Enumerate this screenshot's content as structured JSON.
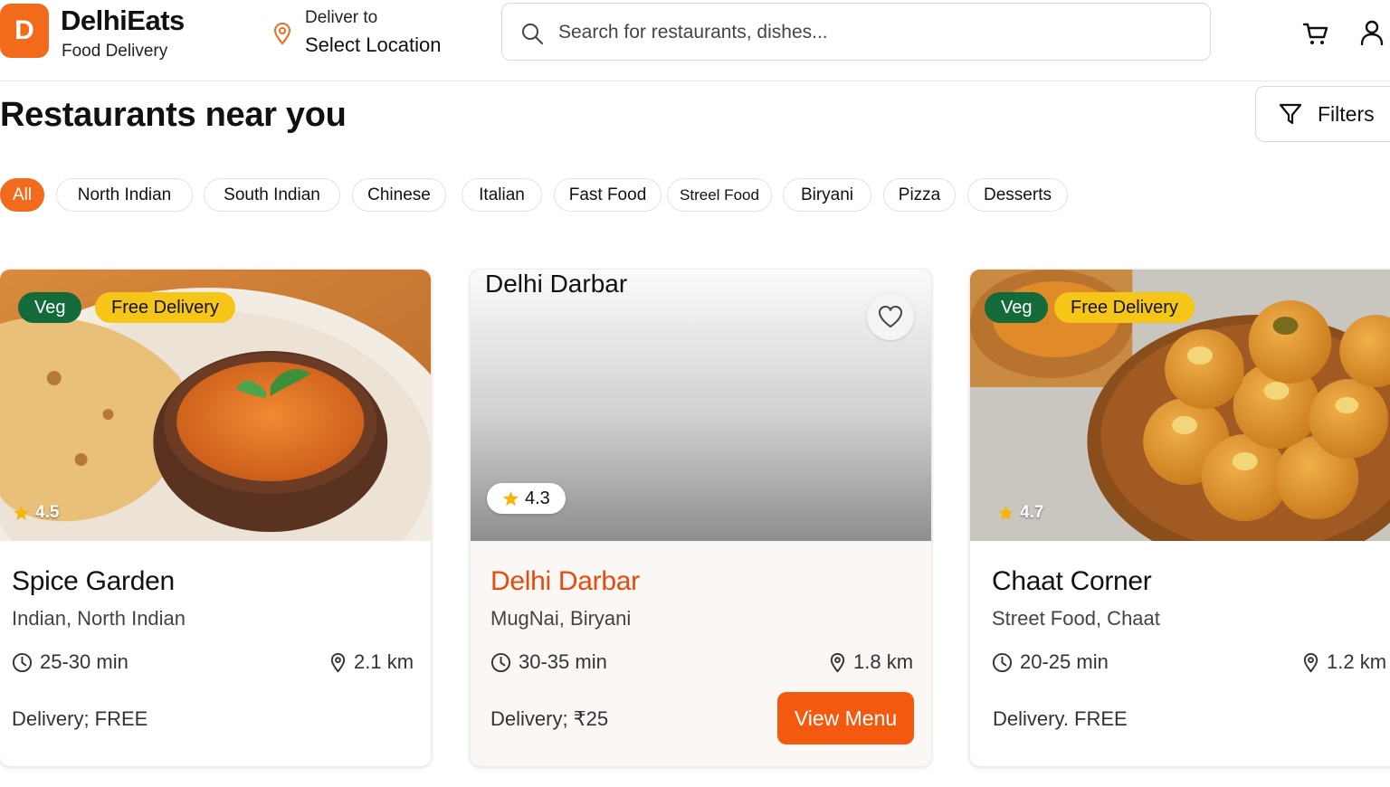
{
  "brand": {
    "logo_letter": "D",
    "name": "DelhiEats",
    "subtitle": "Food Delivery"
  },
  "location": {
    "label": "Deliver to",
    "value": "Select Location"
  },
  "search": {
    "placeholder": "Search for restaurants, dishes..."
  },
  "page": {
    "title": "Restaurants near you",
    "filters_label": "Filters"
  },
  "categories": [
    "All",
    "North Indian",
    "South Indian",
    "Chinese",
    "Italian",
    "Fast Food",
    "Streel Food",
    "Biryani",
    "Pizza",
    "Desserts"
  ],
  "active_category": "All",
  "restaurants": [
    {
      "name": "Spice Garden",
      "cuisine": "Indian, North Indian",
      "time": "25-30 min",
      "distance": "2.1 km",
      "delivery": "Delivery; FREE",
      "rating": "4.5",
      "badges": [
        "Veg",
        "Free Delivery"
      ]
    },
    {
      "name": "Delhi Darbar",
      "image_title": "Delhi Darbar",
      "cuisine": "MugNai, Biryani",
      "time": "30-35 min",
      "distance": "1.8 km",
      "delivery": "Delivery; ₹25",
      "rating": "4.3",
      "action": "View Menu"
    },
    {
      "name": "Chaat Corner",
      "cuisine": "Street Food, Chaat",
      "time": "20-25 min",
      "distance": "1.2 km",
      "delivery": "Delivery. FREE",
      "rating": "4.7",
      "badges": [
        "Veg",
        "Free Delivery"
      ]
    }
  ],
  "colors": {
    "accent": "#f26a1b",
    "veg": "#136b3a",
    "free_delivery": "#f5c618",
    "highlight_name": "#e64a0c"
  }
}
